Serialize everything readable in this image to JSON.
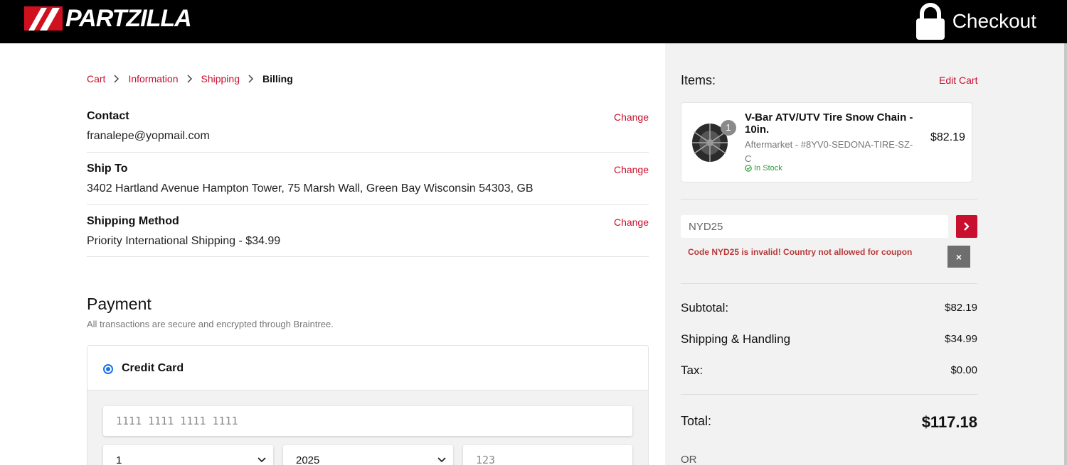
{
  "header": {
    "brand": "PARTZILLA",
    "checkout_label": "Checkout"
  },
  "breadcrumb": {
    "cart": "Cart",
    "information": "Information",
    "shipping": "Shipping",
    "billing": "Billing"
  },
  "review": {
    "contact": {
      "label": "Contact",
      "value": "franalepe@yopmail.com",
      "change": "Change"
    },
    "ship_to": {
      "label": "Ship To",
      "value": "3402 Hartland Avenue Hampton Tower, 75 Marsh Wall, Green Bay Wisconsin 54303, GB",
      "change": "Change"
    },
    "shipping_method": {
      "label": "Shipping Method",
      "value": "Priority International Shipping - $34.99",
      "change": "Change"
    }
  },
  "payment": {
    "title": "Payment",
    "subtitle": "All transactions are secure and encrypted through Braintree.",
    "credit_card_label": "Credit Card",
    "card_number_placeholder": "1111 1111 1111 1111",
    "month_value": "1",
    "year_value": "2025",
    "cvv_placeholder": "123"
  },
  "summary": {
    "items_label": "Items:",
    "edit_cart": "Edit Cart",
    "item": {
      "quantity": "1",
      "name": "V-Bar ATV/UTV Tire Snow Chain - 10in.",
      "sku": "Aftermarket - #8YV0-SEDONA-TIRE-SZ-C",
      "stock": "In Stock",
      "price": "$82.19"
    },
    "coupon": {
      "value": "NYD25",
      "error": "Code NYD25 is invalid! Country not allowed for coupon",
      "dismiss": "×"
    },
    "subtotal_label": "Subtotal:",
    "subtotal_value": "$82.19",
    "shipping_label": "Shipping & Handling",
    "shipping_value": "$34.99",
    "tax_label": "Tax:",
    "tax_value": "$0.00",
    "total_label": "Total:",
    "total_value": "$117.18",
    "or_label": "OR"
  },
  "colors": {
    "accent": "#c8102e",
    "header_bg": "#000000",
    "summary_bg": "#f2f2f2",
    "in_stock": "#2e9b3a"
  }
}
